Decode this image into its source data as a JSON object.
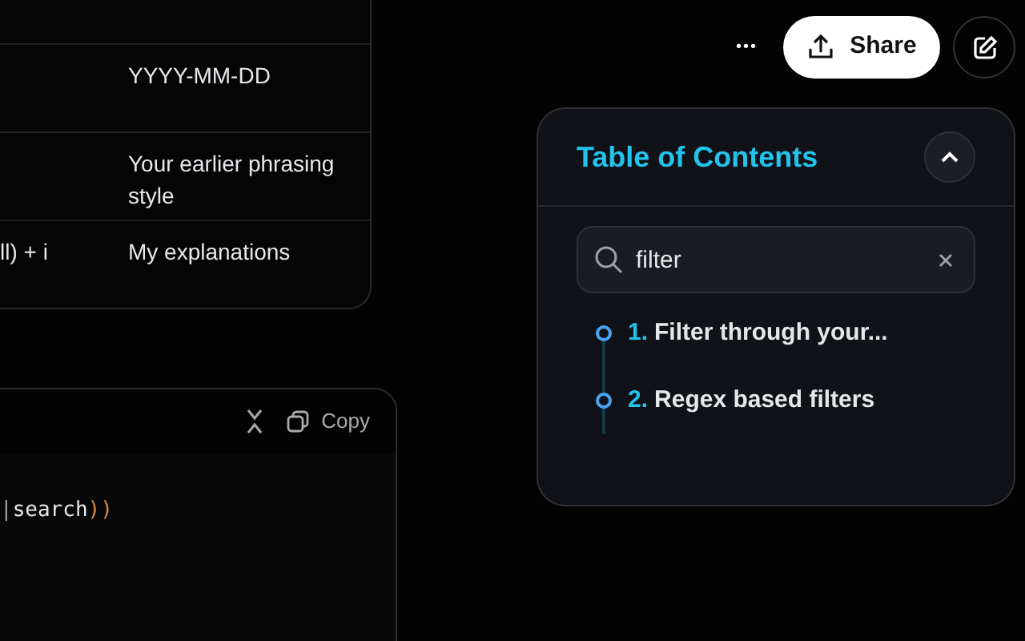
{
  "table": {
    "rows": [
      {
        "column_2": "YYYY-MM-DD"
      },
      {
        "column_2": "Your earlier phrasing style"
      },
      {
        "column_1": "ll) + i",
        "column_2": "My explanations"
      }
    ]
  },
  "code_block": {
    "copy_label": "Copy",
    "line": [
      {
        "kind": "punct",
        "text": "|"
      },
      {
        "kind": "plain",
        "text": "search"
      },
      {
        "kind": "paren",
        "text": "))"
      }
    ]
  },
  "top_bar": {
    "more_label": "•••",
    "share_label": "Share"
  },
  "toc": {
    "title": "Table of Contents",
    "search": {
      "value": "filter"
    },
    "items": [
      {
        "number": "1.",
        "label": "Filter through your..."
      },
      {
        "number": "2.",
        "label": "Regex based filters"
      }
    ]
  }
}
